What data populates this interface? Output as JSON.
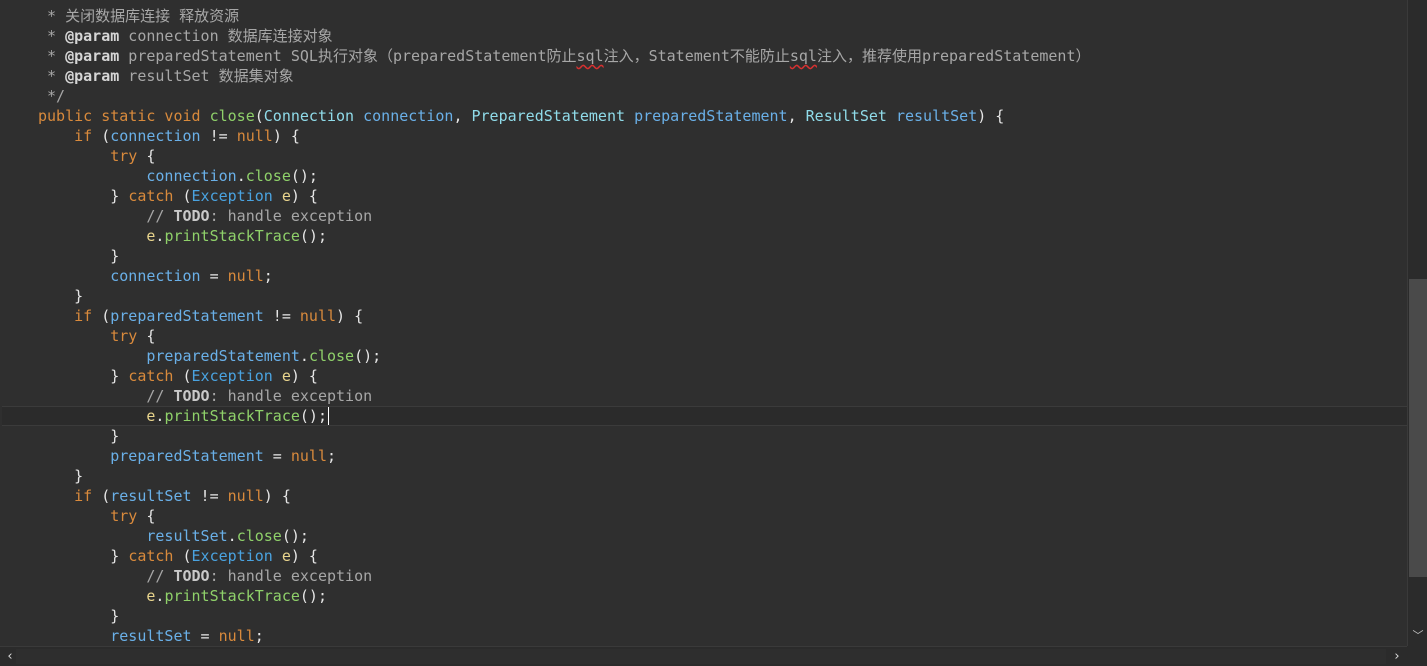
{
  "editor": {
    "language": "java",
    "lines": [
      {
        "tokens": [
          {
            "t": " * 关闭数据库连接 释放资源",
            "c": "javadoc"
          }
        ]
      },
      {
        "tokens": [
          {
            "t": " * ",
            "c": "javadoc"
          },
          {
            "t": "@param",
            "c": "tag"
          },
          {
            "t": " connection 数据库连接对象",
            "c": "javadoc"
          }
        ]
      },
      {
        "tokens": [
          {
            "t": " * ",
            "c": "javadoc"
          },
          {
            "t": "@param",
            "c": "tag"
          },
          {
            "t": " preparedStatement SQL执行对象（preparedStatement防止",
            "c": "javadoc"
          },
          {
            "t": "sql",
            "c": "javadoc spell"
          },
          {
            "t": "注入，Statement不能防止",
            "c": "javadoc"
          },
          {
            "t": "sql",
            "c": "javadoc spell"
          },
          {
            "t": "注入，推荐使用preparedStatement）",
            "c": "javadoc"
          }
        ]
      },
      {
        "tokens": [
          {
            "t": " * ",
            "c": "javadoc"
          },
          {
            "t": "@param",
            "c": "tag"
          },
          {
            "t": " resultSet 数据集对象",
            "c": "javadoc"
          }
        ]
      },
      {
        "tokens": [
          {
            "t": " */",
            "c": "javadoc"
          }
        ]
      },
      {
        "tokens": [
          {
            "t": "public static void ",
            "c": "keyword"
          },
          {
            "t": "close",
            "c": "method"
          },
          {
            "t": "(",
            "c": "plain"
          },
          {
            "t": "Connection ",
            "c": "type"
          },
          {
            "t": "connection",
            "c": "param"
          },
          {
            "t": ", ",
            "c": "plain"
          },
          {
            "t": "PreparedStatement ",
            "c": "type"
          },
          {
            "t": "preparedStatement",
            "c": "param"
          },
          {
            "t": ", ",
            "c": "plain"
          },
          {
            "t": "ResultSet ",
            "c": "type"
          },
          {
            "t": "resultSet",
            "c": "param"
          },
          {
            "t": ") {",
            "c": "plain"
          }
        ]
      },
      {
        "tokens": [
          {
            "t": "    if ",
            "c": "keyword"
          },
          {
            "t": "(",
            "c": "plain"
          },
          {
            "t": "connection",
            "c": "param"
          },
          {
            "t": " != ",
            "c": "plain"
          },
          {
            "t": "null",
            "c": "keyword"
          },
          {
            "t": ") {",
            "c": "plain"
          }
        ]
      },
      {
        "tokens": [
          {
            "t": "        try ",
            "c": "keyword"
          },
          {
            "t": "{",
            "c": "plain"
          }
        ]
      },
      {
        "tokens": [
          {
            "t": "            ",
            "c": "plain"
          },
          {
            "t": "connection",
            "c": "param"
          },
          {
            "t": ".",
            "c": "plain"
          },
          {
            "t": "close",
            "c": "method"
          },
          {
            "t": "();",
            "c": "plain"
          }
        ]
      },
      {
        "tokens": [
          {
            "t": "        } ",
            "c": "plain"
          },
          {
            "t": "catch ",
            "c": "keyword"
          },
          {
            "t": "(",
            "c": "plain"
          },
          {
            "t": "Exception ",
            "c": "exc"
          },
          {
            "t": "e",
            "c": "local"
          },
          {
            "t": ") {",
            "c": "plain"
          }
        ]
      },
      {
        "tokens": [
          {
            "t": "            // ",
            "c": "comment"
          },
          {
            "t": "TODO",
            "c": "todo"
          },
          {
            "t": ": handle exception",
            "c": "comment"
          }
        ]
      },
      {
        "tokens": [
          {
            "t": "            ",
            "c": "plain"
          },
          {
            "t": "e",
            "c": "local"
          },
          {
            "t": ".",
            "c": "plain"
          },
          {
            "t": "printStackTrace",
            "c": "method"
          },
          {
            "t": "();",
            "c": "plain"
          }
        ]
      },
      {
        "tokens": [
          {
            "t": "        }",
            "c": "plain"
          }
        ]
      },
      {
        "tokens": [
          {
            "t": "        ",
            "c": "plain"
          },
          {
            "t": "connection",
            "c": "param"
          },
          {
            "t": " = ",
            "c": "plain"
          },
          {
            "t": "null",
            "c": "keyword"
          },
          {
            "t": ";",
            "c": "plain"
          }
        ]
      },
      {
        "tokens": [
          {
            "t": "    }",
            "c": "plain"
          }
        ]
      },
      {
        "tokens": [
          {
            "t": "    if ",
            "c": "keyword"
          },
          {
            "t": "(",
            "c": "plain"
          },
          {
            "t": "preparedStatement",
            "c": "param"
          },
          {
            "t": " != ",
            "c": "plain"
          },
          {
            "t": "null",
            "c": "keyword"
          },
          {
            "t": ") {",
            "c": "plain"
          }
        ]
      },
      {
        "tokens": [
          {
            "t": "        try ",
            "c": "keyword"
          },
          {
            "t": "{",
            "c": "plain"
          }
        ]
      },
      {
        "tokens": [
          {
            "t": "            ",
            "c": "plain"
          },
          {
            "t": "preparedStatement",
            "c": "param"
          },
          {
            "t": ".",
            "c": "plain"
          },
          {
            "t": "close",
            "c": "method"
          },
          {
            "t": "();",
            "c": "plain"
          }
        ]
      },
      {
        "tokens": [
          {
            "t": "        } ",
            "c": "plain"
          },
          {
            "t": "catch ",
            "c": "keyword"
          },
          {
            "t": "(",
            "c": "plain"
          },
          {
            "t": "Exception ",
            "c": "exc"
          },
          {
            "t": "e",
            "c": "local"
          },
          {
            "t": ") {",
            "c": "plain"
          }
        ]
      },
      {
        "tokens": [
          {
            "t": "            // ",
            "c": "comment"
          },
          {
            "t": "TODO",
            "c": "todo"
          },
          {
            "t": ": handle exception",
            "c": "comment"
          }
        ]
      },
      {
        "current": true,
        "tokens": [
          {
            "t": "            ",
            "c": "plain"
          },
          {
            "t": "e",
            "c": "local"
          },
          {
            "t": ".",
            "c": "plain"
          },
          {
            "t": "printStackTrace",
            "c": "method"
          },
          {
            "t": "();",
            "c": "plain"
          }
        ]
      },
      {
        "tokens": [
          {
            "t": "        }",
            "c": "plain"
          }
        ]
      },
      {
        "tokens": [
          {
            "t": "        ",
            "c": "plain"
          },
          {
            "t": "preparedStatement",
            "c": "param"
          },
          {
            "t": " = ",
            "c": "plain"
          },
          {
            "t": "null",
            "c": "keyword"
          },
          {
            "t": ";",
            "c": "plain"
          }
        ]
      },
      {
        "tokens": [
          {
            "t": "    }",
            "c": "plain"
          }
        ]
      },
      {
        "tokens": [
          {
            "t": "    if ",
            "c": "keyword"
          },
          {
            "t": "(",
            "c": "plain"
          },
          {
            "t": "resultSet",
            "c": "param"
          },
          {
            "t": " != ",
            "c": "plain"
          },
          {
            "t": "null",
            "c": "keyword"
          },
          {
            "t": ") {",
            "c": "plain"
          }
        ]
      },
      {
        "tokens": [
          {
            "t": "        try ",
            "c": "keyword"
          },
          {
            "t": "{",
            "c": "plain"
          }
        ]
      },
      {
        "tokens": [
          {
            "t": "            ",
            "c": "plain"
          },
          {
            "t": "resultSet",
            "c": "param"
          },
          {
            "t": ".",
            "c": "plain"
          },
          {
            "t": "close",
            "c": "method"
          },
          {
            "t": "();",
            "c": "plain"
          }
        ]
      },
      {
        "tokens": [
          {
            "t": "        } ",
            "c": "plain"
          },
          {
            "t": "catch ",
            "c": "keyword"
          },
          {
            "t": "(",
            "c": "plain"
          },
          {
            "t": "Exception ",
            "c": "exc"
          },
          {
            "t": "e",
            "c": "local"
          },
          {
            "t": ") {",
            "c": "plain"
          }
        ]
      },
      {
        "tokens": [
          {
            "t": "            // ",
            "c": "comment"
          },
          {
            "t": "TODO",
            "c": "todo"
          },
          {
            "t": ": handle exception",
            "c": "comment"
          }
        ]
      },
      {
        "tokens": [
          {
            "t": "            ",
            "c": "plain"
          },
          {
            "t": "e",
            "c": "local"
          },
          {
            "t": ".",
            "c": "plain"
          },
          {
            "t": "printStackTrace",
            "c": "method"
          },
          {
            "t": "();",
            "c": "plain"
          }
        ]
      },
      {
        "tokens": [
          {
            "t": "        }",
            "c": "plain"
          }
        ]
      },
      {
        "tokens": [
          {
            "t": "        ",
            "c": "plain"
          },
          {
            "t": "resultSet",
            "c": "param"
          },
          {
            "t": " = ",
            "c": "plain"
          },
          {
            "t": "null",
            "c": "keyword"
          },
          {
            "t": ";",
            "c": "plain"
          }
        ]
      }
    ]
  },
  "scrollbars": {
    "vertical": {
      "down_icon": "chevron-down-icon",
      "down_glyph": "﹀"
    },
    "horizontal": {
      "left_icon": "chevron-left-icon",
      "left_glyph": "‹",
      "right_icon": "chevron-right-icon",
      "right_glyph": "›"
    }
  },
  "colors": {
    "background": "#2f2f2f",
    "keyword": "#d98a3c",
    "method": "#8fd16a",
    "type": "#90dcea",
    "variable": "#6ab0e8",
    "comment": "#a7a7a7"
  }
}
